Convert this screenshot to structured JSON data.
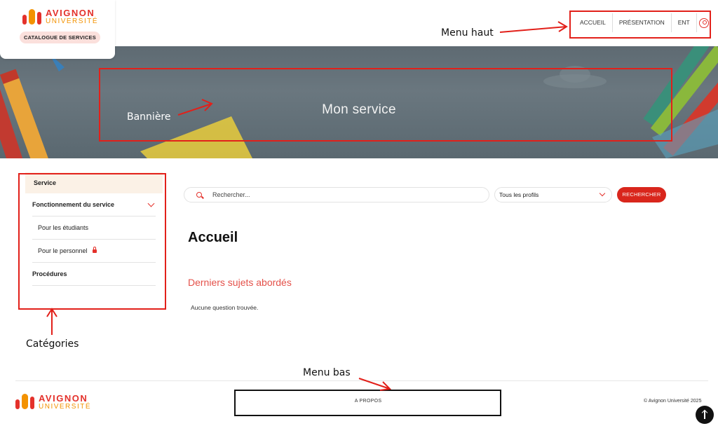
{
  "header": {
    "logo_line1": "AVIGNON",
    "logo_line2": "UNIVERSITÉ",
    "catalogue_label": "CATALOGUE DE SERVICES",
    "menu": [
      "ACCUEIL",
      "PRÉSENTATION",
      "ENT"
    ],
    "user_icon": "user-circle-icon"
  },
  "banner": {
    "title": "Mon service"
  },
  "sidebar": {
    "active": "Service",
    "items": [
      {
        "label": "Fonctionnement du service",
        "icon": "chevron-down-icon"
      },
      {
        "label": "Pour les étudiants"
      },
      {
        "label": "Pour le personnel",
        "icon": "lock-icon"
      },
      {
        "label": "Procédures"
      }
    ]
  },
  "search": {
    "placeholder": "Rechercher...",
    "profile_value": "Tous les profils",
    "button_label": "RECHERCHER"
  },
  "main": {
    "title": "Accueil",
    "subtitle": "Derniers sujets abordés",
    "empty_text": "Aucune question trouvée."
  },
  "footer": {
    "logo_line1": "AVIGNON",
    "logo_line2": "UNIVERSITÉ",
    "menu_item": "A PROPOS",
    "copyright": "© Avignon Université 2025"
  },
  "annotations": {
    "menu_haut": "Menu haut",
    "banniere": "Bannière",
    "categories": "Catégories",
    "menu_bas": "Menu bas"
  },
  "colors": {
    "accent_red": "#e4312b",
    "accent_orange": "#f39200",
    "annotation_red": "#e2201a"
  }
}
